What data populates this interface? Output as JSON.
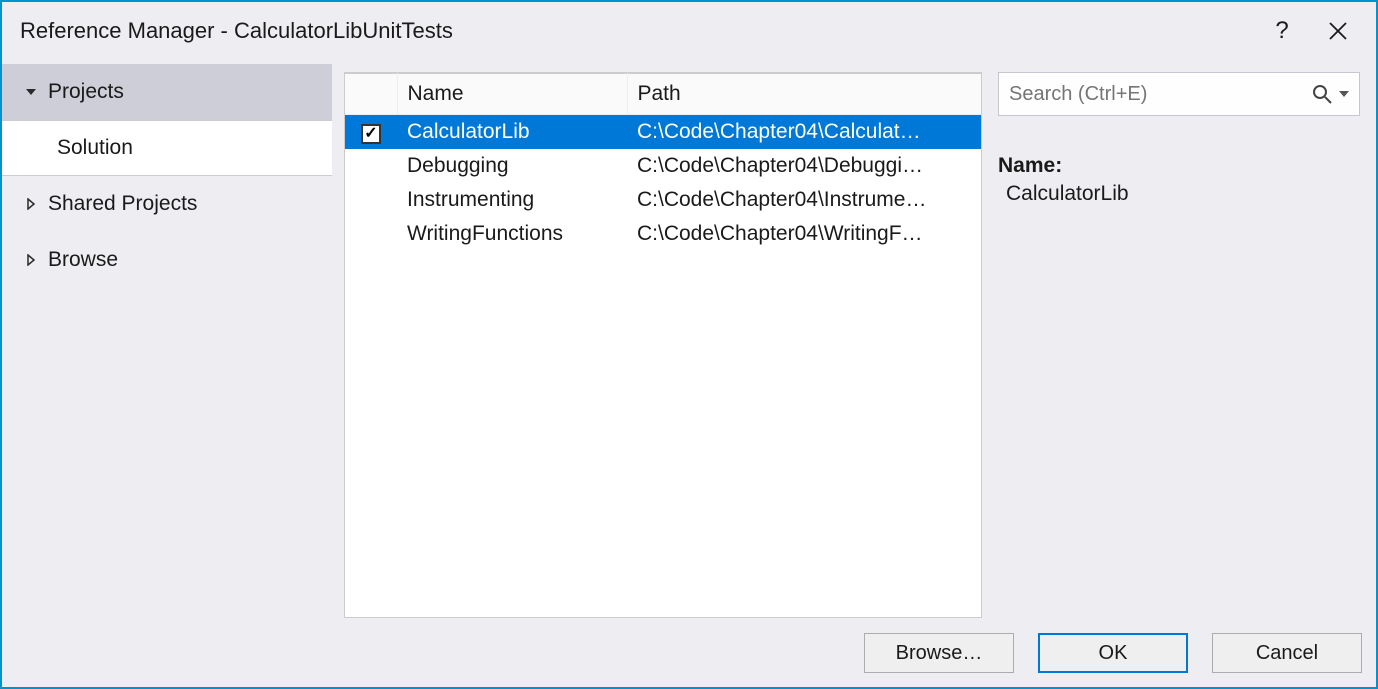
{
  "title": "Reference Manager - CalculatorLibUnitTests",
  "sidebar": {
    "projects": "Projects",
    "solution": "Solution",
    "shared": "Shared Projects",
    "browse": "Browse"
  },
  "search": {
    "placeholder": "Search (Ctrl+E)"
  },
  "columns": {
    "name": "Name",
    "path": "Path"
  },
  "rows": [
    {
      "checked": true,
      "selected": true,
      "name": "CalculatorLib",
      "path": "C:\\Code\\Chapter04\\Calculat…"
    },
    {
      "checked": false,
      "selected": false,
      "name": "Debugging",
      "path": "C:\\Code\\Chapter04\\Debuggi…"
    },
    {
      "checked": false,
      "selected": false,
      "name": "Instrumenting",
      "path": "C:\\Code\\Chapter04\\Instrume…"
    },
    {
      "checked": false,
      "selected": false,
      "name": "WritingFunctions",
      "path": "C:\\Code\\Chapter04\\WritingF…"
    }
  ],
  "details": {
    "label": "Name:",
    "value": "CalculatorLib"
  },
  "buttons": {
    "browse": "Browse…",
    "ok": "OK",
    "cancel": "Cancel"
  }
}
